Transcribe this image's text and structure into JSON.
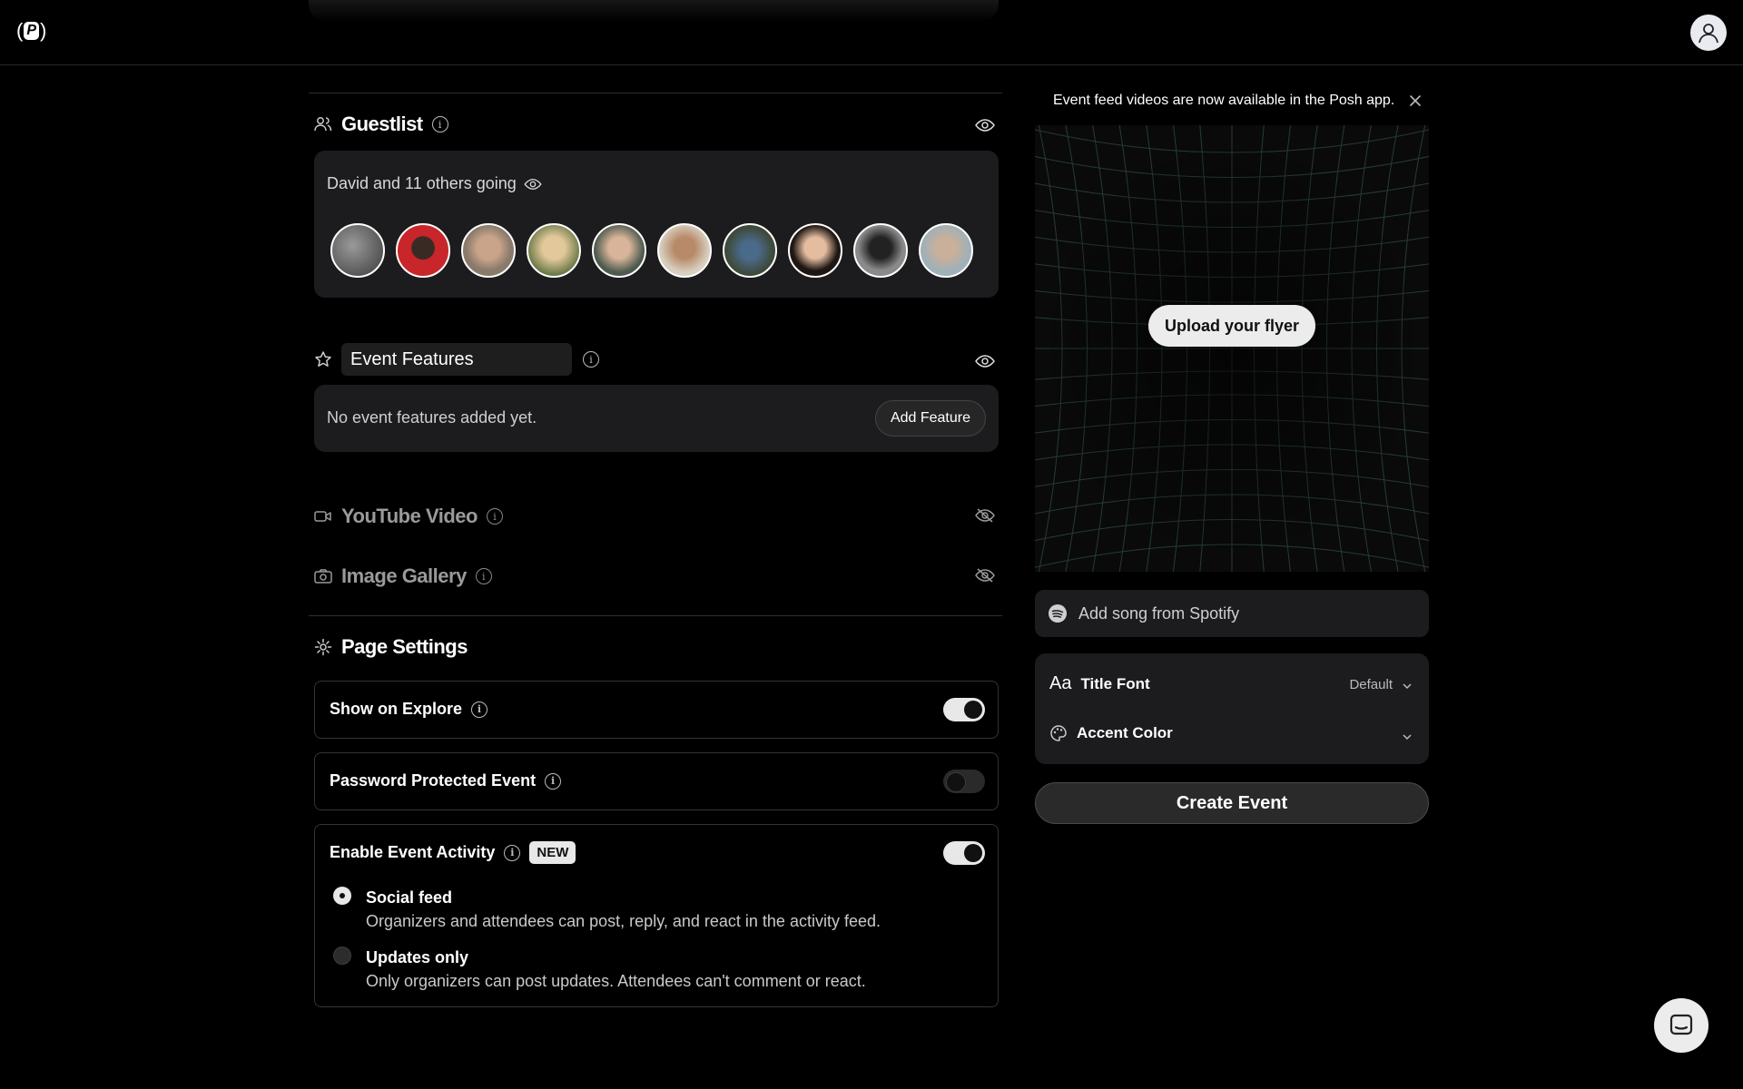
{
  "header": {
    "logo_text": "P",
    "profile_icon": "user-icon"
  },
  "guestlist": {
    "title": "Guestlist",
    "going_text": "David and 11 others going",
    "avatar_colors": [
      "#6b6b6b",
      "#c8262a",
      "#8a7a6a",
      "#cbb48a",
      "#4d5a4e",
      "#a89a86",
      "#3e4a3a",
      "#8b6a5a",
      "#555555",
      "#9aa8b0"
    ]
  },
  "event_features": {
    "title": "Event Features",
    "empty_text": "No event features added yet.",
    "add_button": "Add Feature"
  },
  "youtube": {
    "title": "YouTube Video"
  },
  "gallery": {
    "title": "Image Gallery"
  },
  "page_settings": {
    "title": "Page Settings",
    "show_on_explore": {
      "label": "Show on Explore",
      "enabled": true
    },
    "password_protected": {
      "label": "Password Protected Event",
      "enabled": false
    },
    "event_activity": {
      "label": "Enable Event Activity",
      "badge": "NEW",
      "enabled": true,
      "options": [
        {
          "title": "Social feed",
          "desc": "Organizers and attendees can post, reply, and react in the activity feed.",
          "selected": true
        },
        {
          "title": "Updates only",
          "desc": "Only organizers can post updates. Attendees can't comment or react.",
          "selected": false
        }
      ]
    }
  },
  "sidebar": {
    "banner": "Event feed videos are now available in the Posh app.",
    "upload_button": "Upload your flyer",
    "spotify_placeholder": "Add song from Spotify",
    "title_font_icon": "Aa",
    "title_font_label": "Title Font",
    "title_font_value": "Default",
    "accent_color_label": "Accent Color",
    "create_button": "Create Event"
  }
}
